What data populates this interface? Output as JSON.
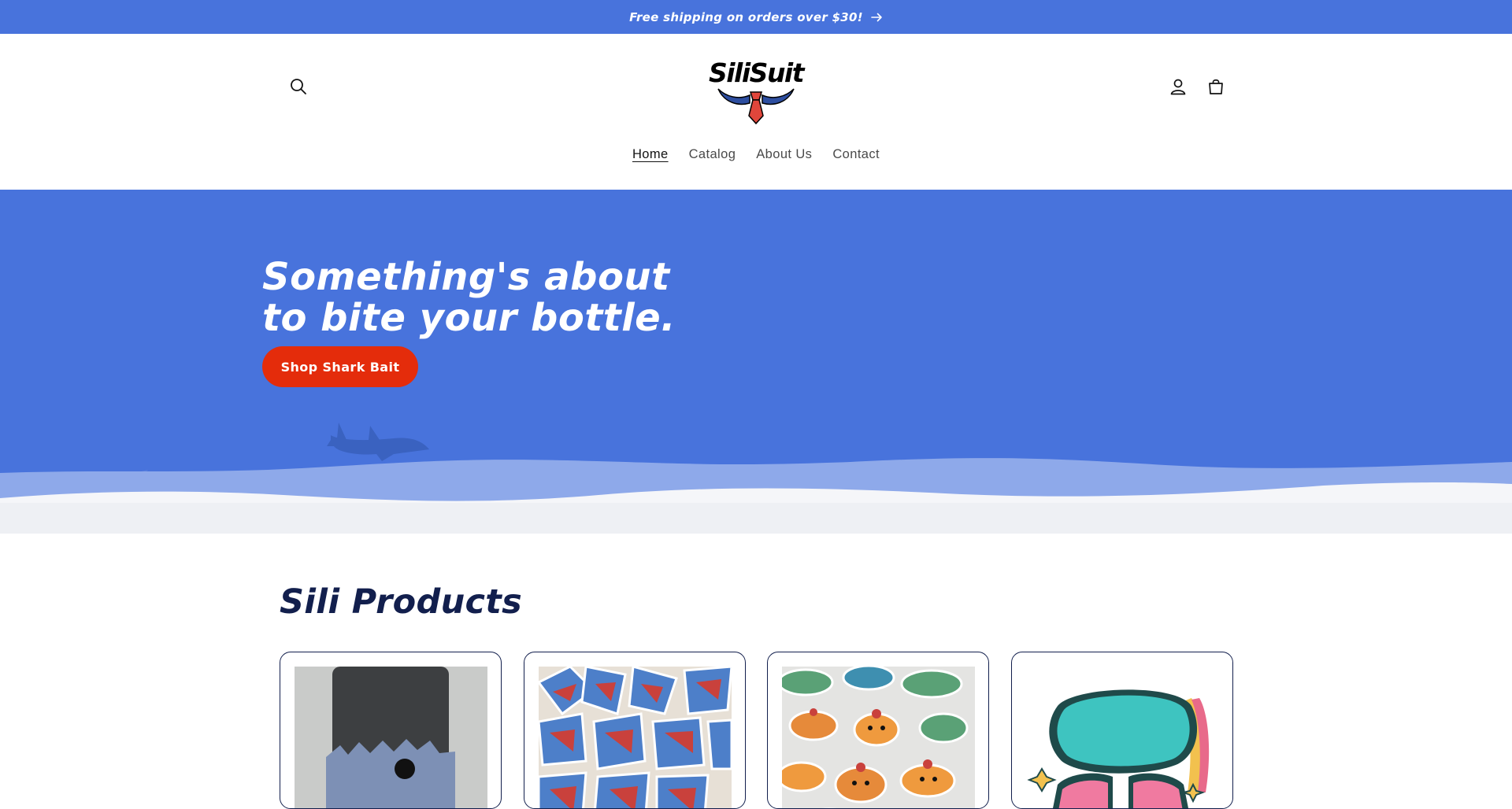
{
  "announcement": {
    "text": "Free shipping on orders over $30!",
    "arrow_icon": "arrow-right-icon"
  },
  "header": {
    "logo_text": "SiliSuit",
    "icons": {
      "search": "search-icon",
      "account": "user-icon",
      "cart": "cart-icon"
    },
    "nav": [
      {
        "label": "Home",
        "active": true
      },
      {
        "label": "Catalog",
        "active": false
      },
      {
        "label": "About Us",
        "active": false
      },
      {
        "label": "Contact",
        "active": false
      }
    ]
  },
  "hero": {
    "heading_line1": "Something's about",
    "heading_line2": "to bite your bottle.",
    "button_label": "Shop Shark Bait"
  },
  "products": {
    "title": "Sili Products",
    "items": [
      {
        "image": "shark bottle boot"
      },
      {
        "image": "shark stickers"
      },
      {
        "image": "fish stickers"
      },
      {
        "image": "Stay Sili sticker"
      }
    ]
  },
  "colors": {
    "brand_blue": "#4873dc",
    "button_red": "#e42c0b",
    "heading_navy": "#121f4d"
  }
}
